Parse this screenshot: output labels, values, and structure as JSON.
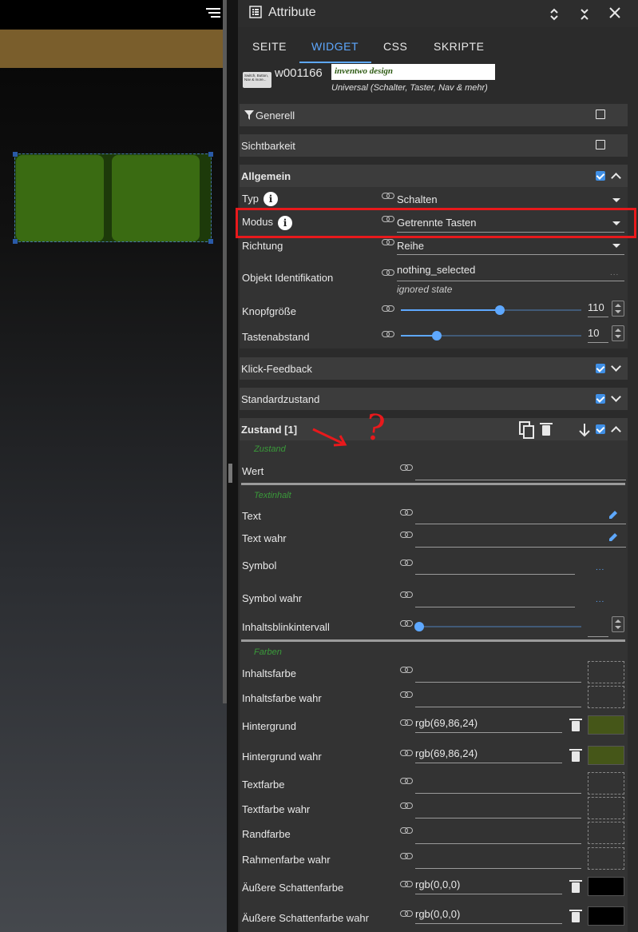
{
  "editor": {
    "menu_icon": "menu-icon"
  },
  "panel": {
    "title": "Attribute",
    "tabs": [
      "SEITE",
      "WIDGET",
      "CSS",
      "SKRIPTE"
    ],
    "widget_id": "w001166",
    "widget_set": "inventwo design",
    "widget_type": "Universal (Schalter, Taster, Nav & mehr)",
    "widget_thumb_text": "Switch, Button, Nav & more..."
  },
  "sections": {
    "generell": "Generell",
    "sichtbarkeit": "Sichtbarkeit",
    "allgemein": "Allgemein",
    "klick": "Klick-Feedback",
    "standard": "Standardzustand",
    "zustand": "Zustand [1]"
  },
  "allgemein": {
    "typ_label": "Typ",
    "typ_value": "Schalten",
    "modus_label": "Modus",
    "modus_value": "Getrennte Tasten",
    "richtung_label": "Richtung",
    "richtung_value": "Reihe",
    "oid_label": "Objekt Identifikation",
    "oid_value": "nothing_selected",
    "oid_note": "ignored state",
    "knopf_label": "Knopfgröße",
    "knopf_value": "110",
    "knopf_fraction": 0.55,
    "abstand_label": "Tastenabstand",
    "abstand_value": "10",
    "abstand_fraction": 0.2
  },
  "zustand": {
    "grp_zustand": "Zustand",
    "wert": "Wert",
    "grp_text": "Textinhalt",
    "text": "Text",
    "text_wahr": "Text wahr",
    "symbol": "Symbol",
    "symbol_wahr": "Symbol wahr",
    "blink": "Inhaltsblinkintervall",
    "grp_farben": "Farben",
    "inhaltsfarbe": "Inhaltsfarbe",
    "inhaltsfarbe_wahr": "Inhaltsfarbe wahr",
    "hintergrund": "Hintergrund",
    "hintergrund_value": "rgb(69,86,24)",
    "hintergrund_wahr": "Hintergrund wahr",
    "hintergrund_wahr_value": "rgb(69,86,24)",
    "textfarbe": "Textfarbe",
    "textfarbe_wahr": "Textfarbe wahr",
    "randfarbe": "Randfarbe",
    "rahmenfarbe_wahr": "Rahmenfarbe wahr",
    "schatten": "Äußere Schattenfarbe",
    "schatten_value": "rgb(0,0,0)",
    "schatten_wahr": "Äußere Schattenfarbe wahr",
    "schatten_wahr_value": "rgb(0,0,0)"
  },
  "colors": {
    "accent": "#5ea8ff",
    "widget_green": "#3a6b12",
    "swatch_green": "#455618",
    "annotation_red": "#e8191c"
  },
  "annotation": {
    "question_mark": "?"
  }
}
